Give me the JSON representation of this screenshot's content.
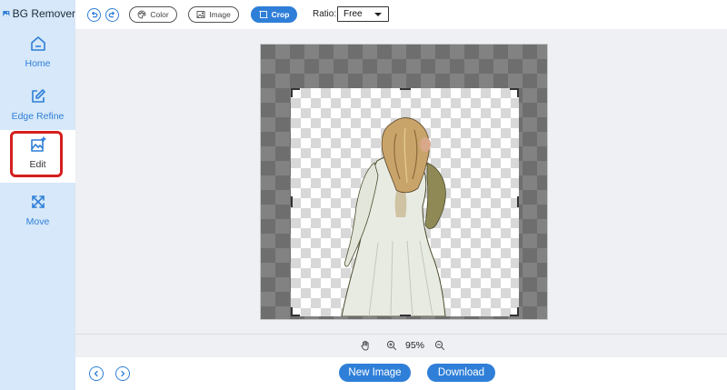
{
  "app": {
    "title": "BG Remover"
  },
  "sidebar": {
    "items": [
      {
        "label": "Home",
        "icon": "home-icon"
      },
      {
        "label": "Edge Refine",
        "icon": "edge-refine-icon"
      },
      {
        "label": "Edit",
        "icon": "edit-image-icon",
        "active": true
      },
      {
        "label": "Move",
        "icon": "move-icon"
      }
    ]
  },
  "toolbar": {
    "undo_icon": "undo-icon",
    "redo_icon": "redo-icon",
    "color_label": "Color",
    "image_label": "Image",
    "crop_label": "Crop",
    "ratio_label": "Ratio:",
    "ratio_value": "Free"
  },
  "zoom": {
    "value": "95%"
  },
  "footer": {
    "new_image_label": "New Image",
    "download_label": "Download"
  },
  "colors": {
    "accent": "#2f7fd8",
    "sidebar_bg": "#d6e8f9",
    "highlight": "#d41f1f"
  }
}
